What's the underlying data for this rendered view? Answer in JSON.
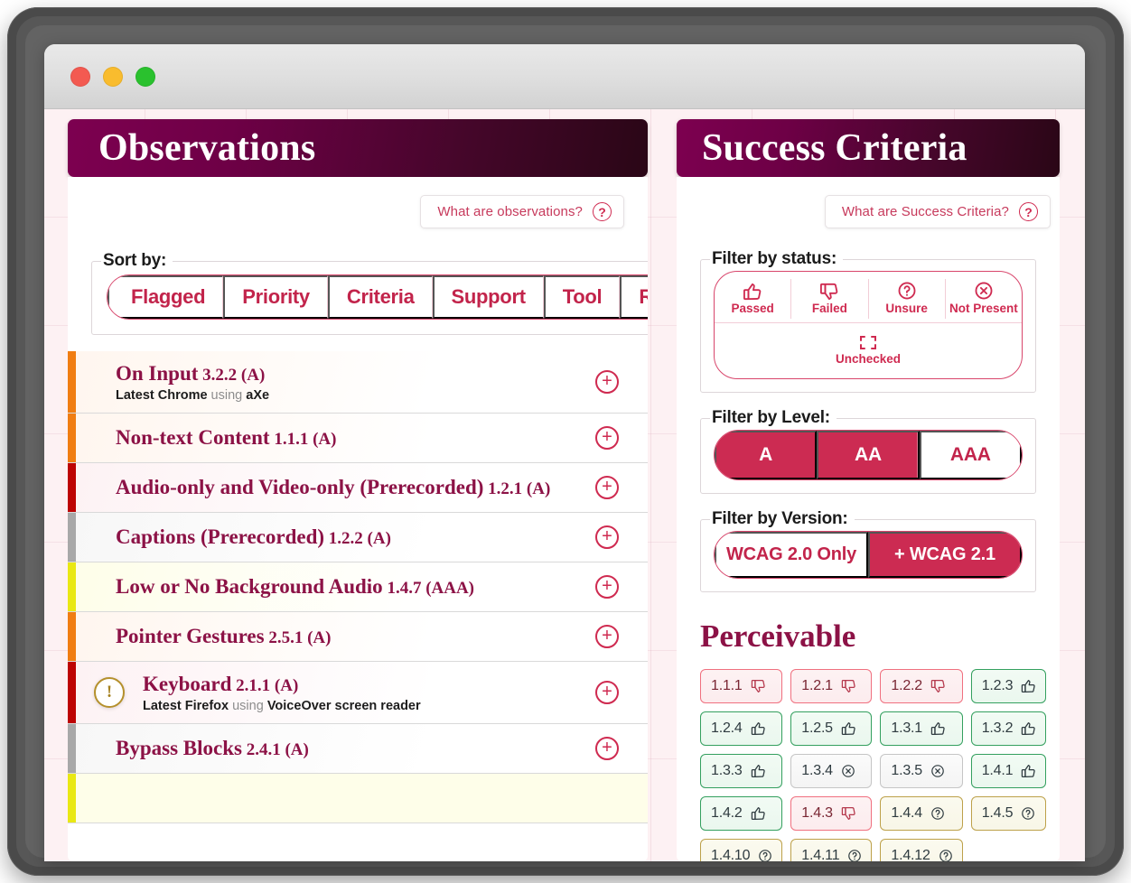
{
  "window": {
    "traffic_lights": [
      "close",
      "minimize",
      "maximize"
    ]
  },
  "observations": {
    "title": "Observations",
    "help": {
      "label": "What are observations?",
      "icon": "question-mark-icon"
    },
    "sort": {
      "legend": "Sort by:",
      "options": [
        "Flagged",
        "Priority",
        "Criteria",
        "Support",
        "Tool",
        "Reset"
      ]
    },
    "rows": [
      {
        "title": "On Input",
        "number": "3.2.2",
        "level": "(A)",
        "bar": "#f07d12",
        "sub_browser": "Latest Chrome",
        "sub_mid": "using",
        "sub_tool": "aXe",
        "flagged": false,
        "action": "add-observation"
      },
      {
        "title": "Non-text Content",
        "number": "1.1.1",
        "level": "(A)",
        "bar": "#f07d12",
        "sub_browser": "",
        "sub_mid": "",
        "sub_tool": "",
        "flagged": false,
        "action": "add-observation"
      },
      {
        "title": "Audio-only and Video-only (Prerecorded)",
        "number": "1.2.1",
        "level": "(A)",
        "bar": "#bd0404",
        "sub_browser": "",
        "sub_mid": "",
        "sub_tool": "",
        "flagged": false,
        "action": "add-observation"
      },
      {
        "title": "Captions (Prerecorded)",
        "number": "1.2.2",
        "level": "(A)",
        "bar": "#a8a8a8",
        "sub_browser": "",
        "sub_mid": "",
        "sub_tool": "",
        "flagged": false,
        "action": "add-observation"
      },
      {
        "title": "Low or No Background Audio",
        "number": "1.4.7",
        "level": "(AAA)",
        "bar": "#e9e814",
        "sub_browser": "",
        "sub_mid": "",
        "sub_tool": "",
        "flagged": false,
        "action": "add-observation"
      },
      {
        "title": "Pointer Gestures",
        "number": "2.5.1",
        "level": "(A)",
        "bar": "#f07d12",
        "sub_browser": "",
        "sub_mid": "",
        "sub_tool": "",
        "flagged": false,
        "action": "add-observation"
      },
      {
        "title": "Keyboard",
        "number": "2.1.1",
        "level": "(A)",
        "bar": "#bd0404",
        "sub_browser": "Latest Firefox",
        "sub_mid": "using",
        "sub_tool": "VoiceOver screen reader",
        "flagged": true,
        "action": "add-observation"
      },
      {
        "title": "Bypass Blocks",
        "number": "2.4.1",
        "level": "(A)",
        "bar": "#a8a8a8",
        "sub_browser": "",
        "sub_mid": "",
        "sub_tool": "",
        "flagged": false,
        "action": "add-observation"
      },
      {
        "title": "",
        "number": "",
        "level": "",
        "bar": "#e9e814",
        "sub_browser": "",
        "sub_mid": "",
        "sub_tool": "",
        "flagged": false,
        "action": "add-observation"
      }
    ],
    "add_icon_label": "+"
  },
  "criteria": {
    "title": "Success Criteria",
    "help": {
      "label": "What are Success Criteria?",
      "icon": "question-mark-icon"
    },
    "status_filter": {
      "legend": "Filter by status:",
      "options": [
        {
          "label": "Passed",
          "icon": "thumbs-up-icon"
        },
        {
          "label": "Failed",
          "icon": "thumbs-down-icon"
        },
        {
          "label": "Unsure",
          "icon": "question-circle-icon"
        },
        {
          "label": "Not Present",
          "icon": "x-circle-icon"
        }
      ],
      "extra": {
        "label": "Unchecked",
        "icon": "dashed-square-icon"
      }
    },
    "level_filter": {
      "legend": "Filter by Level:",
      "options": [
        {
          "label": "A",
          "active": true
        },
        {
          "label": "AA",
          "active": true
        },
        {
          "label": "AAA",
          "active": false
        }
      ]
    },
    "version_filter": {
      "legend": "Filter by Version:",
      "options": [
        {
          "label": "WCAG 2.0 Only",
          "active": false
        },
        {
          "label": "+ WCAG 2.1",
          "active": true
        }
      ]
    },
    "section_title": "Perceivable",
    "chips": [
      {
        "id": "1.1.1",
        "status": "failed"
      },
      {
        "id": "1.2.1",
        "status": "failed"
      },
      {
        "id": "1.2.2",
        "status": "failed"
      },
      {
        "id": "1.2.3",
        "status": "passed"
      },
      {
        "id": "1.2.4",
        "status": "passed"
      },
      {
        "id": "1.2.5",
        "status": "passed"
      },
      {
        "id": "1.3.1",
        "status": "passed"
      },
      {
        "id": "1.3.2",
        "status": "passed"
      },
      {
        "id": "1.3.3",
        "status": "passed"
      },
      {
        "id": "1.3.4",
        "status": "not-present"
      },
      {
        "id": "1.3.5",
        "status": "not-present"
      },
      {
        "id": "1.4.1",
        "status": "passed"
      },
      {
        "id": "1.4.2",
        "status": "passed"
      },
      {
        "id": "1.4.3",
        "status": "failed"
      },
      {
        "id": "1.4.4",
        "status": "unsure"
      },
      {
        "id": "1.4.5",
        "status": "unsure"
      },
      {
        "id": "1.4.10",
        "status": "unsure"
      },
      {
        "id": "1.4.11",
        "status": "unsure"
      },
      {
        "id": "1.4.12",
        "status": "unsure"
      }
    ]
  },
  "colors": {
    "header_gradient_start": "#7d0050",
    "header_gradient_end": "#2a0616",
    "accent_crimson": "#cc2b52",
    "heading_maroon": "#8c1246",
    "page_background": "#fdf1f3",
    "bar_orange": "#f07d12",
    "bar_red": "#bd0404",
    "bar_gray": "#a8a8a8",
    "bar_yellow": "#e9e814",
    "status_passed": "#34a05f",
    "status_failed": "#f0707f",
    "status_unsure": "#bda14a",
    "status_not_present": "#c5c5c5"
  }
}
